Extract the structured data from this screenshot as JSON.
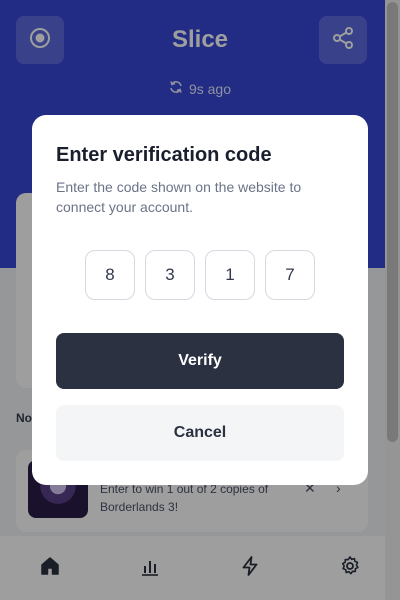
{
  "app": {
    "title": "Slice",
    "sync_status": "9s ago",
    "section_label": "No",
    "header_color": "#3748d6",
    "left_button_icon": "record-icon",
    "right_button_icon": "share-icon"
  },
  "notification": {
    "text": "Enter to win 1 out of 2 copies of Borderlands 3!",
    "dismiss": "✕",
    "open": "›"
  },
  "bottom_nav": {
    "items": [
      {
        "icon": "home-icon",
        "selected": true
      },
      {
        "icon": "stats-icon",
        "selected": false
      },
      {
        "icon": "lightning-icon",
        "selected": false
      },
      {
        "icon": "gear-icon",
        "selected": false
      }
    ]
  },
  "modal": {
    "title": "Enter verification code",
    "description": "Enter the code shown on the website to connect your account.",
    "digits": [
      "8",
      "3",
      "1",
      "7"
    ],
    "verify_label": "Verify",
    "cancel_label": "Cancel",
    "verify_color": "#2b3140"
  }
}
